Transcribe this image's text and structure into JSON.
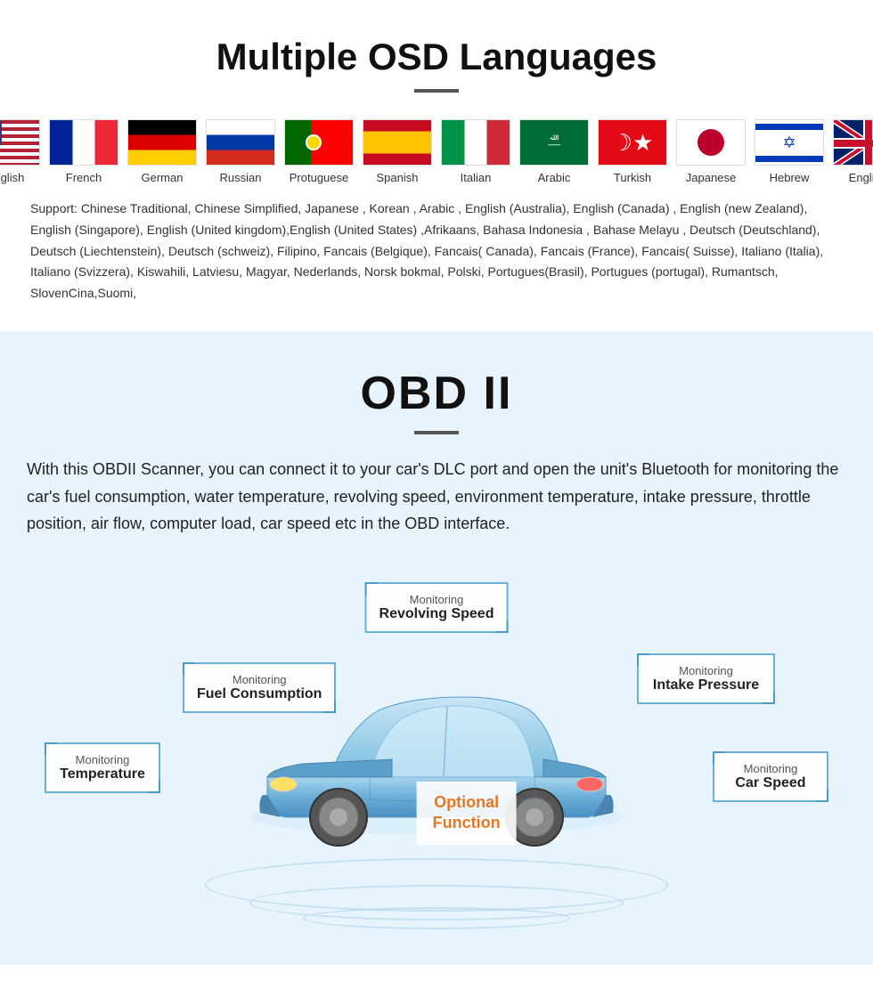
{
  "osd": {
    "title": "Multiple OSD Languages",
    "flags": [
      {
        "label": "English",
        "type": "us"
      },
      {
        "label": "French",
        "type": "fr"
      },
      {
        "label": "German",
        "type": "de"
      },
      {
        "label": "Russian",
        "type": "ru"
      },
      {
        "label": "Protuguese",
        "type": "pt"
      },
      {
        "label": "Spanish",
        "type": "es"
      },
      {
        "label": "Italian",
        "type": "it"
      },
      {
        "label": "Arabic",
        "type": "sa"
      },
      {
        "label": "Turkish",
        "type": "tr"
      },
      {
        "label": "Japanese",
        "type": "jp"
      },
      {
        "label": "Hebrew",
        "type": "il"
      },
      {
        "label": "English",
        "type": "gb"
      }
    ],
    "support_text": "Support: Chinese Traditional, Chinese Simplified, Japanese , Korean , Arabic , English (Australia), English (Canada) , English (new Zealand), English (Singapore), English (United kingdom),English (United States) ,Afrikaans, Bahasa Indonesia , Bahase Melayu , Deutsch (Deutschland), Deutsch (Liechtenstein), Deutsch (schweiz), Filipino, Fancais (Belgique), Fancais( Canada), Fancais (France), Fancais( Suisse), Italiano (Italia), Italiano (Svizzera), Kiswahili, Latviesu, Magyar, Nederlands, Norsk bokmal, Polski, Portugues(Brasil), Portugues (portugal), Rumantsch, SlovenCina,Suomi,"
  },
  "obd": {
    "title": "OBD II",
    "description": "With this OBDII Scanner, you can connect it to your car's DLC port and open the unit's Bluetooth for monitoring the car's fuel consumption, water temperature, revolving speed, environment temperature, intake pressure, throttle position, air flow, computer load, car speed etc in the OBD interface.",
    "monitors": [
      {
        "id": "revolving",
        "sub": "Monitoring",
        "main": "Revolving Speed"
      },
      {
        "id": "fuel",
        "sub": "Monitoring",
        "main": "Fuel Consumption"
      },
      {
        "id": "intake",
        "sub": "Monitoring",
        "main": "Intake Pressure"
      },
      {
        "id": "temperature",
        "sub": "Monitoring",
        "main": "Temperature"
      },
      {
        "id": "carspeed",
        "sub": "Monitoring",
        "main": "Car Speed"
      }
    ],
    "optional": {
      "line1": "Optional",
      "line2": "Function"
    }
  }
}
